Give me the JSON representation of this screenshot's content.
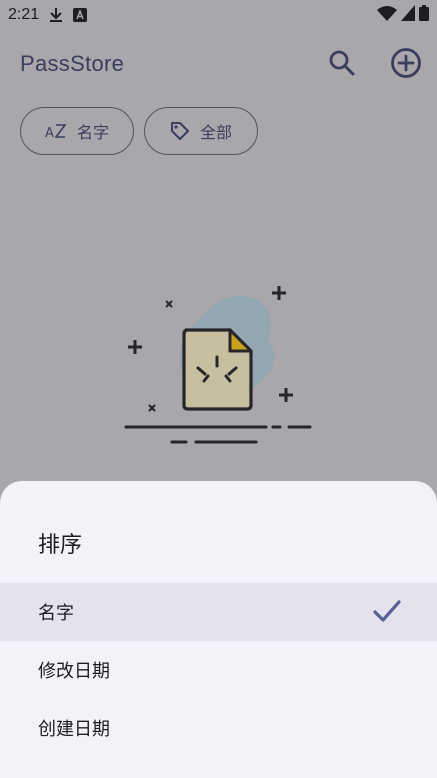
{
  "status_bar": {
    "time": "2:21",
    "icons": [
      "download-icon",
      "a-icon",
      "wifi-icon",
      "signal-icon",
      "battery-icon"
    ]
  },
  "app_bar": {
    "title": "PassStore",
    "actions": [
      "search-icon",
      "add-circle-icon"
    ]
  },
  "chips": [
    {
      "label": "名字",
      "icon": "sort-az-icon"
    },
    {
      "label": "全部",
      "icon": "tag-icon"
    }
  ],
  "empty_state": {
    "icon": "empty-document-illustration"
  },
  "sort_sheet": {
    "title": "排序",
    "options": [
      {
        "label": "名字",
        "selected": true
      },
      {
        "label": "修改日期",
        "selected": false
      },
      {
        "label": "创建日期",
        "selected": false
      }
    ]
  },
  "colors": {
    "scrim_background": "#a9a7ab",
    "sheet_background": "#f4f2f8",
    "selected_row": "#e4e2ec",
    "accent": "#5b5f97",
    "title_text": "#3a3d5c"
  }
}
